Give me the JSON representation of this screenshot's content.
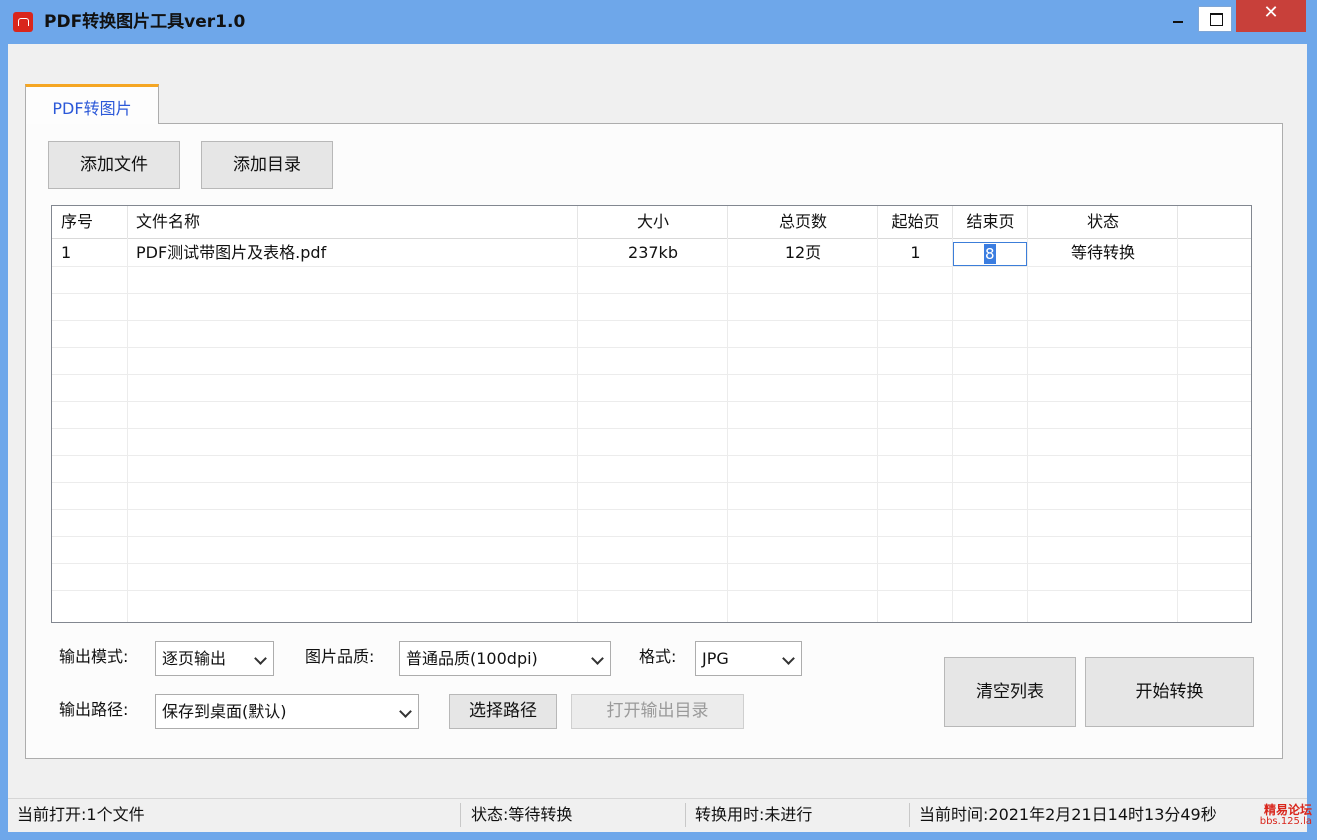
{
  "window": {
    "title": "PDF转换图片工具ver1.0",
    "close_glyph": "✕"
  },
  "tab": {
    "label": "PDF转图片"
  },
  "toolbar": {
    "add_file": "添加文件",
    "add_dir": "添加目录"
  },
  "table": {
    "headers": [
      "序号",
      "文件名称",
      "大小",
      "总页数",
      "起始页",
      "结束页",
      "状态"
    ],
    "rows": [
      {
        "index": "1",
        "filename": "PDF测试带图片及表格.pdf",
        "size": "237kb",
        "total_pages": "12页",
        "start_page": "1",
        "end_page": "8",
        "status": "等待转换"
      }
    ]
  },
  "options": {
    "output_mode_label": "输出模式:",
    "output_mode_value": "逐页输出",
    "quality_label": "图片品质:",
    "quality_value": "普通品质(100dpi)",
    "format_label": "格式:",
    "format_value": "JPG",
    "output_path_label": "输出路径:",
    "output_path_value": "保存到桌面(默认)",
    "choose_path": "选择路径",
    "open_output_dir": "打开输出目录",
    "clear_list": "清空列表",
    "start_convert": "开始转换"
  },
  "status": {
    "current_open": "当前打开:1个文件",
    "state": "状态:等待转换",
    "elapsed": "转换用时:未进行",
    "current_time": "当前时间:2021年2月21日14时13分49秒"
  },
  "watermark": {
    "line1": "精易论坛",
    "line2": "bbs.125.la"
  },
  "colors": {
    "titlebar": "#6ea7ea",
    "tab_accent": "#f5a623",
    "close_button": "#c8403a",
    "selection": "#3b7de0"
  }
}
